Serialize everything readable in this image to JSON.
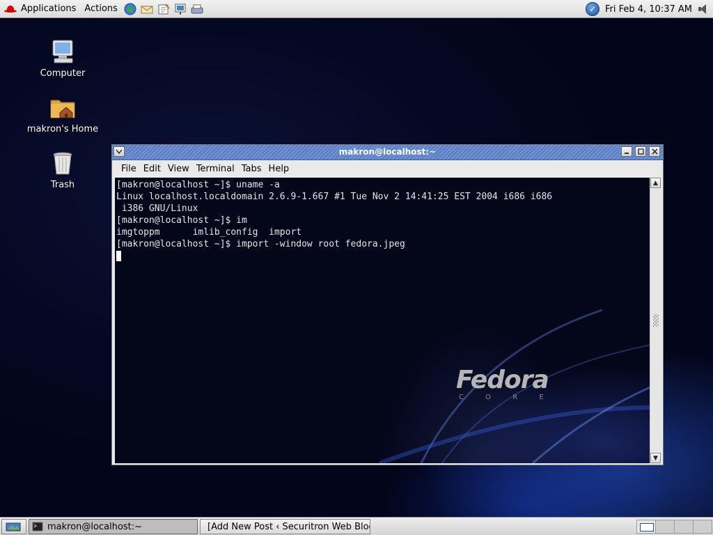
{
  "top_panel": {
    "applications_label": "Applications",
    "actions_label": "Actions",
    "launchers": [
      "web-browser-icon",
      "email-icon",
      "office-icon",
      "presentation-icon",
      "print-icon"
    ],
    "clock": "Fri Feb  4, 10:37 AM"
  },
  "desktop": {
    "icons": [
      {
        "name": "computer-icon",
        "label": "Computer"
      },
      {
        "name": "home-folder-icon",
        "label": "makron's Home"
      },
      {
        "name": "trash-icon",
        "label": "Trash"
      }
    ]
  },
  "terminal": {
    "title": "makron@localhost:~",
    "menu": [
      "File",
      "Edit",
      "View",
      "Terminal",
      "Tabs",
      "Help"
    ],
    "lines": [
      "[makron@localhost ~]$ uname -a",
      "Linux localhost.localdomain 2.6.9-1.667 #1 Tue Nov 2 14:41:25 EST 2004 i686 i686",
      " i386 GNU/Linux",
      "[makron@localhost ~]$ im",
      "imgtoppm      imlib_config  import",
      "[makron@localhost ~]$ import -window root fedora.jpeg"
    ],
    "wallpaper_logo": "Fedora",
    "wallpaper_logo_sub": "C O R E"
  },
  "bottom_panel": {
    "tasks": [
      {
        "label": "makron@localhost:~",
        "icon": "terminal-icon",
        "active": true
      },
      {
        "label": "[Add New Post ‹ Securitron Web Blog",
        "icon": "firefox-icon",
        "active": false
      }
    ],
    "workspaces": 4,
    "active_workspace": 1
  },
  "colors": {
    "titlebar": "#5a7fc4",
    "desktop": "#04061a",
    "panel": "#dcdcdc"
  }
}
